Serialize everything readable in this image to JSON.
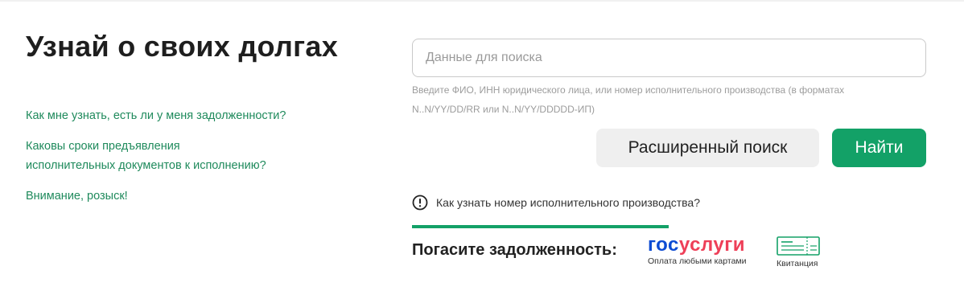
{
  "page": {
    "title": "Узнай о своих долгах"
  },
  "links": {
    "debt_check": "Как мне узнать, есть ли у меня задолженности?",
    "terms_line1": "Каковы сроки предъявления",
    "terms_line2": "исполнительных документов к исполнению?",
    "wanted": "Внимание, розыск!"
  },
  "search": {
    "placeholder": "Данные для поиска",
    "value": "",
    "hint": "Введите ФИО, ИНН юридического лица, или номер исполнительного производства (в форматах N..N/YY/DD/RR или N..N/YY/DDDDD-ИП)"
  },
  "buttons": {
    "advanced": "Расширенный поиск",
    "find": "Найти"
  },
  "howto": {
    "label": "Как узнать номер исполнительного производства?",
    "icon": "info-icon"
  },
  "payment": {
    "label": "Погасите задолженность:",
    "gosuslugi_blue": "гос",
    "gosuslugi_red": "услуги",
    "gosuslugi_caption": "Оплата любыми картами",
    "receipt_caption": "Квитанция",
    "receipt_icon": "receipt-icon"
  },
  "colors": {
    "accent_green": "#13a167",
    "link_green": "#1f8a5c",
    "gos_blue": "#0d4cd3",
    "gos_red": "#ee3f58"
  }
}
